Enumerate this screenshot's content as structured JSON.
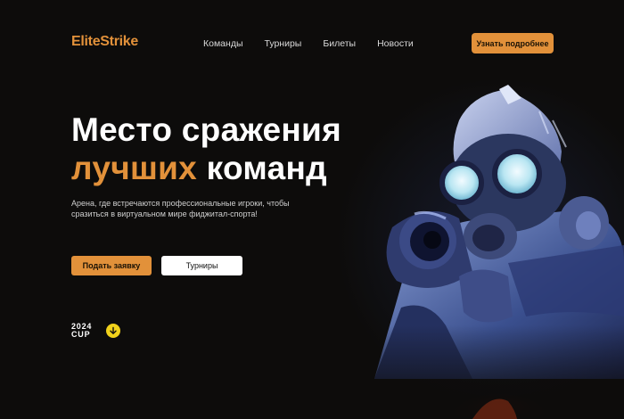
{
  "header": {
    "logo": "EliteStrike",
    "nav": [
      {
        "label": "Команды"
      },
      {
        "label": "Турниры"
      },
      {
        "label": "Билеты"
      },
      {
        "label": "Новости"
      }
    ],
    "cta_label": "Узнать подробнее"
  },
  "hero": {
    "title_line1": "Место сражения",
    "title_accent": "лучших",
    "title_rest": "команд",
    "subtitle": "Арена, где встречаются профессиональные игроки, чтобы сразиться в виртуальном мире фиджитал-спорта!",
    "apply_label": "Подать заявку",
    "tournaments_label": "Турниры",
    "cup_year": "2024",
    "cup_label": "CUP"
  },
  "colors": {
    "accent": "#e2913a",
    "background": "#0d0c0b",
    "scroll_badge": "#f1d21b"
  },
  "icons": {
    "scroll": "arrow-down-icon",
    "hero_image": "soldier-gas-mask-illustration"
  }
}
